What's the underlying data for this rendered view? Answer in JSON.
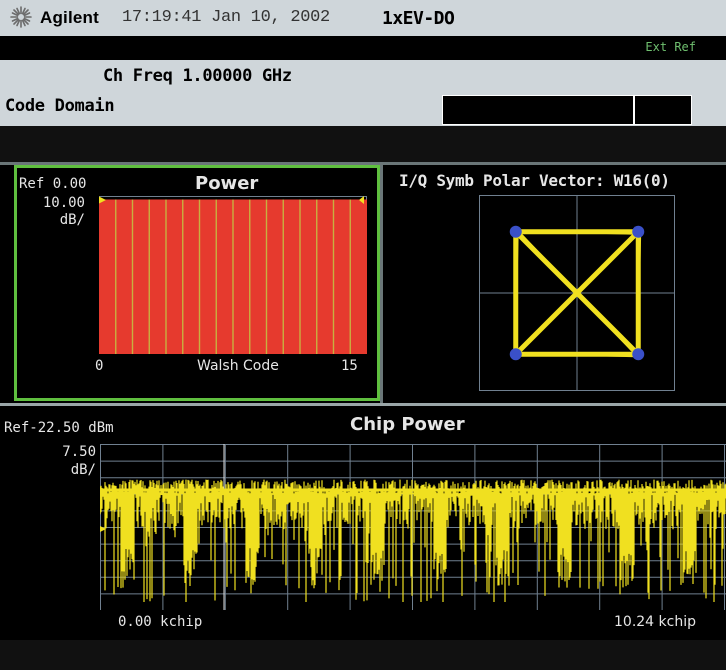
{
  "titlebar": {
    "brand": "Agilent",
    "datetime": "17:19:41  Jan 10, 2002",
    "mode": "1xEV-DO",
    "logo_icon": "agilent-spark-icon"
  },
  "status": {
    "ext_ref": "Ext Ref"
  },
  "header": {
    "ch_freq": "Ch Freq 1.00000 GHz",
    "measurement": "Code Domain"
  },
  "colors": {
    "panel_bg": "#cfd6da",
    "active_window_border": "#5fbf3f",
    "bar_fill": "#e63a2e",
    "trace": "#f0e020",
    "marker": "#f0e020",
    "grid": "#708090",
    "iq_points": "#3a50c8"
  },
  "power_window": {
    "ref": "Ref 0.00",
    "title": "Power",
    "scale_value": "10.00",
    "scale_unit": "dB/",
    "x_start": "0",
    "x_label": "Walsh Code",
    "x_end": "15"
  },
  "iq_window": {
    "title": "I/Q Symb Polar Vector: W16(0)"
  },
  "chip_window": {
    "ref": "Ref-22.50 dBm",
    "title": "Chip Power",
    "scale_value": "7.50",
    "scale_unit": "dB/",
    "x_start": "0.00 kchip",
    "x_end": "10.24 kchip"
  },
  "chart_data": [
    {
      "type": "bar",
      "title": "Power",
      "xlabel": "Walsh Code",
      "categories": [
        "0",
        "1",
        "2",
        "3",
        "4",
        "5",
        "6",
        "7",
        "8",
        "9",
        "10",
        "11",
        "12",
        "13",
        "14",
        "15"
      ],
      "values": [
        -2.2,
        -2.2,
        -2.2,
        -2.2,
        -2.2,
        -2.2,
        -2.2,
        -2.2,
        -2.2,
        -2.2,
        -2.2,
        -2.2,
        -2.2,
        -2.2,
        -2.2,
        -2.2
      ],
      "ylim": [
        -100,
        0
      ],
      "grid": true
    },
    {
      "type": "scatter",
      "title": "I/Q Symb Polar Vector: W16(0)",
      "series": [
        {
          "values": [
            [
              -1,
              1
            ],
            [
              1,
              1
            ],
            [
              -1,
              -1
            ],
            [
              1,
              -1
            ]
          ]
        }
      ],
      "xlim": [
        -1.6,
        1.6
      ],
      "ylim": [
        -1.6,
        1.6
      ],
      "grid": true
    },
    {
      "type": "line",
      "title": "Chip Power",
      "xlim": [
        0,
        10.24
      ],
      "ylim": [
        -97.5,
        -22.5
      ],
      "grid": true,
      "reference_level": -22.5
    }
  ]
}
